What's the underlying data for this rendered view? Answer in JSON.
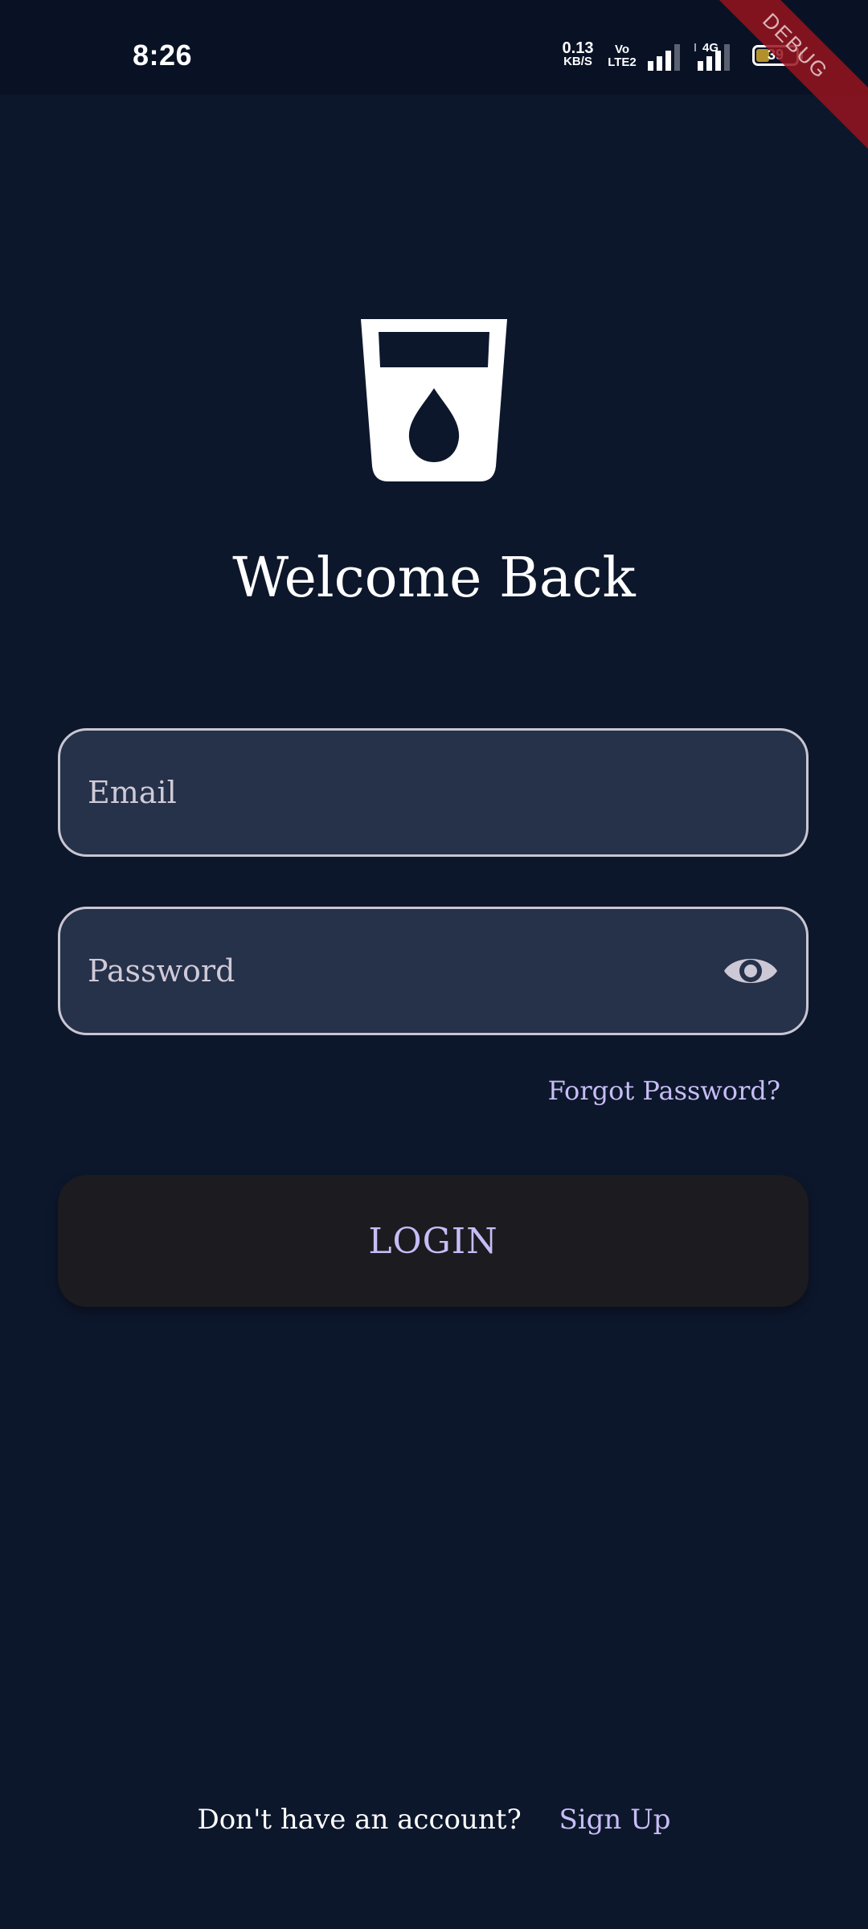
{
  "status_bar": {
    "time": "8:26",
    "net_speed_value": "0.13",
    "net_speed_unit": "KB/S",
    "volte_label_top": "Vo",
    "volte_label_bottom": "LTE2",
    "network_type": "4G",
    "battery_level": "39",
    "battery_fraction": 0.39
  },
  "debug_banner": "DEBUG",
  "icons": {
    "logo": "water-glass-icon",
    "password_toggle": "eye-icon"
  },
  "login": {
    "title": "Welcome Back",
    "email_placeholder": "Email",
    "email_value": "",
    "password_placeholder": "Password",
    "password_value": "",
    "forgot_password": "Forgot Password?",
    "login_button": "LOGIN",
    "signup_prompt": "Don't have an account?",
    "signup_link": "Sign Up"
  },
  "colors": {
    "background": "#0d172c",
    "field_background": "#26314a",
    "accent": "#c7bdf5",
    "button_background": "#1c1b20"
  }
}
